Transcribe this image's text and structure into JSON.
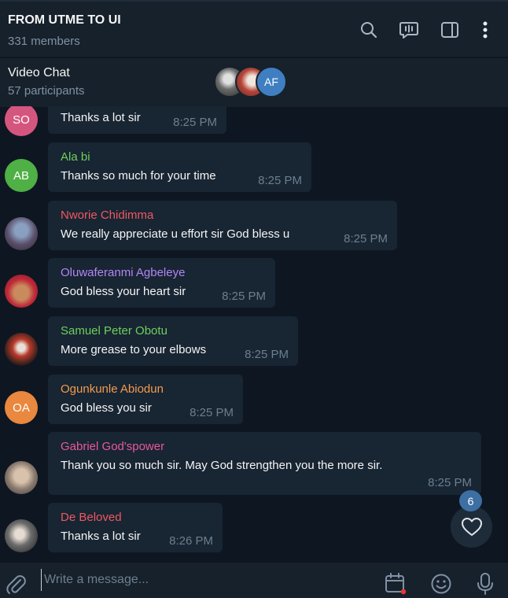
{
  "header": {
    "title": "FROM UTME TO UI",
    "members": "331 members",
    "icons": [
      "search-icon",
      "live-stream-icon",
      "sidebar-icon",
      "more-vertical-icon"
    ]
  },
  "video_chat": {
    "title": "Video Chat",
    "participants": "57 participants",
    "avatar_initials": "AF"
  },
  "messages": [
    {
      "name": "",
      "text": "Thanks a lot sir",
      "time": "8:25 PM",
      "avatar": "SO",
      "avatar_color": "#d4567f"
    },
    {
      "name": "Ala bi",
      "text": "Thanks so much for your time",
      "time": "8:25 PM",
      "avatar": "AB",
      "avatar_color": "#4fb045",
      "name_color": "#6fcf5d"
    },
    {
      "name": "Nworie Chidimma",
      "text": "We really appreciate u effort sir God bless u",
      "time": "8:25 PM",
      "name_color": "#f0585f"
    },
    {
      "name": "Oluwaferanmi Agbeleye",
      "text": "God bless your heart sir",
      "time": "8:25 PM",
      "name_color": "#b286f5"
    },
    {
      "name": "Samuel Peter Obotu",
      "text": "More grease to your elbows",
      "time": "8:25 PM",
      "name_color": "#6fcf5d"
    },
    {
      "name": "Ogunkunle Abiodun",
      "text": "God bless you sir",
      "time": "8:25 PM",
      "avatar": "OA",
      "avatar_color": "#e9883e",
      "name_color": "#f39b4c"
    },
    {
      "name": "Gabriel God'spower",
      "text": "Thank you so much sir. May God strengthen you the more sir.",
      "time": "8:25 PM",
      "name_color": "#e8599a"
    },
    {
      "name": "De Beloved",
      "text": "Thanks a lot sir",
      "time": "8:26 PM",
      "name_color": "#f0585f"
    }
  ],
  "reactions": {
    "badge_count": "6",
    "icon": "heart-icon"
  },
  "composer": {
    "placeholder": "Write a message...",
    "icons": [
      "paperclip-icon",
      "schedule-icon",
      "emoji-icon",
      "microphone-icon"
    ]
  },
  "colors": {
    "background": "#0e1621",
    "panel": "#17212b",
    "bubble": "#182533",
    "accent": "#3d6fa3"
  }
}
